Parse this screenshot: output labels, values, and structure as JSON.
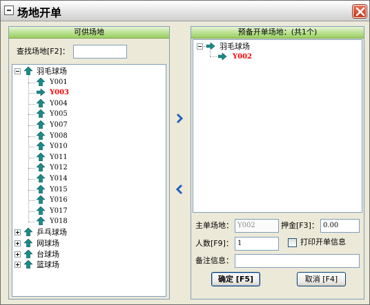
{
  "window": {
    "title": "场地开单"
  },
  "left_panel": {
    "header": "可供场地",
    "search_label": "查找场地[F2]：",
    "search_value": "",
    "tree": {
      "badminton": {
        "label": "羽毛球场",
        "items": [
          "Y001",
          "Y003",
          "Y004",
          "Y005",
          "Y007",
          "Y008",
          "Y010",
          "Y011",
          "Y012",
          "Y014",
          "Y015",
          "Y016",
          "Y017",
          "Y018"
        ],
        "selected": "Y003"
      },
      "pingpong": "乒乓球场",
      "tennis": "网球场",
      "billiards": "台球场",
      "basketball": "篮球场"
    }
  },
  "right_panel": {
    "header": "预备开单场地：(共1个)",
    "tree": {
      "group": "羽毛球场",
      "item": "Y002"
    },
    "main_venue_label": "主单场地：",
    "main_venue_value": "Y002",
    "deposit_label": "押金[F3]：",
    "deposit_value": "0.00",
    "people_label": "人数[F9]：",
    "people_value": "1",
    "print_label": "打印开单信息",
    "print_checked": false,
    "remark_label": "备注信息：",
    "remark_value": "",
    "confirm_label": "确定 [F5]",
    "cancel_label": "取消 [F4]"
  },
  "colors": {
    "selected_text": "#ff0000",
    "header_green": "#9bcf63",
    "arrow_teal": "#1a8a8a",
    "arrow_blue": "#1f5fbf"
  }
}
